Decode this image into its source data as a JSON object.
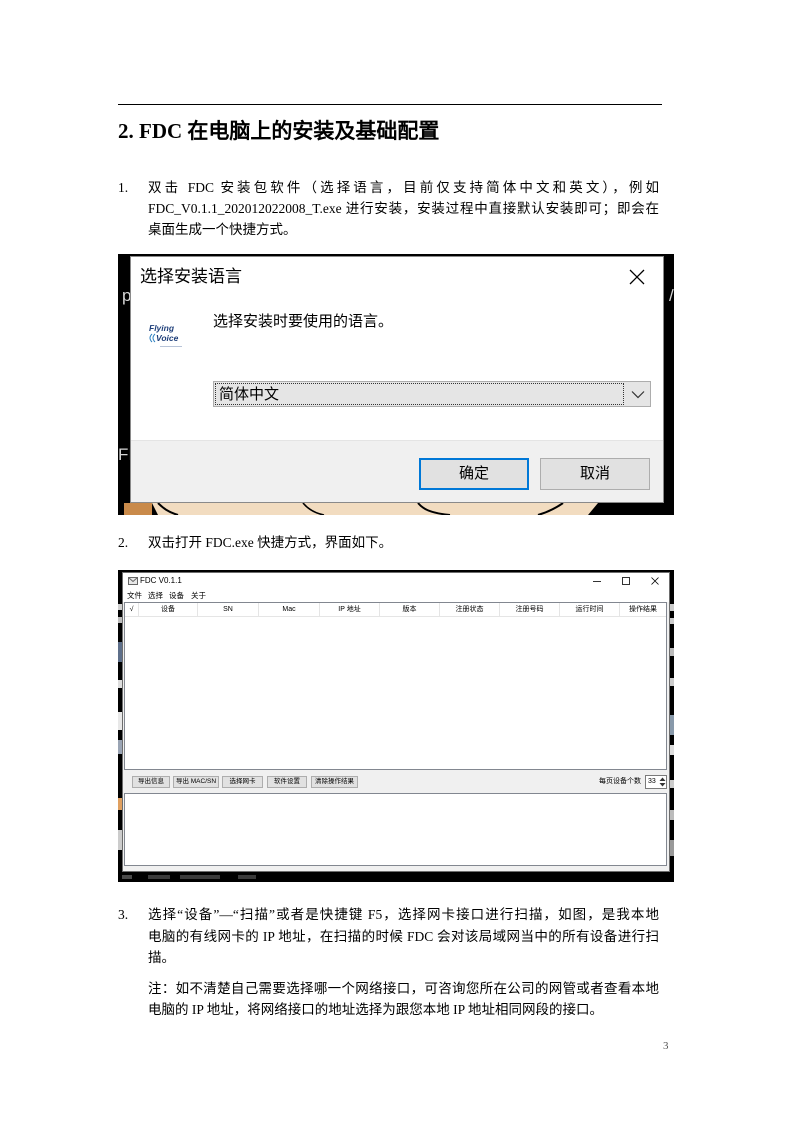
{
  "heading": "2. FDC 在电脑上的安装及基础配置",
  "steps": [
    {
      "marker": "1.",
      "lines": [
        "双击 FDC 安装包软件（选择语言，目前仅支持简体中文和英文），例如",
        "FDC_V0.1.1_202012022008_T.exe 进行安装，安装过程中直接默认安装即可；即会在",
        "桌面生成一个快捷方式。"
      ]
    },
    {
      "marker": "2.",
      "lines": [
        "双击打开 FDC.exe 快捷方式，界面如下。"
      ]
    },
    {
      "marker": "3.",
      "lines": [
        "选择“设备”—“扫描”或者是快捷键 F5，选择网卡接口进行扫描，如图，是我本地",
        "电脑的有线网卡的 IP 地址，在扫描的时候 FDC 会对该局域网当中的所有设备进行扫",
        "描。"
      ],
      "note_lines": [
        "注：如不清楚自己需要选择哪一个网络接口，可咨询您所在公司的网管或者查看本地",
        "电脑的 IP 地址，将网络接口的地址选择为跟您本地 IP 地址相同网段的接口。"
      ]
    }
  ],
  "language_dialog": {
    "title": "选择安装语言",
    "logo_text": [
      "Flying",
      "Voice"
    ],
    "prompt": "选择安装时要使用的语言。",
    "selected_language": "简体中文",
    "ok_label": "确定",
    "cancel_label": "取消",
    "background_fragments": [
      "p",
      "FI",
      "/"
    ],
    "icons": {
      "close": "close-icon",
      "dropdown": "chevron-down-icon"
    },
    "colors": {
      "default_button_border": "#0078d7",
      "footer": "#f0f0f0"
    }
  },
  "fdc_window": {
    "title": "FDC V0.1.1",
    "menu": [
      "文件",
      "选择",
      "设备",
      "关于"
    ],
    "columns": [
      "√",
      "设备",
      "SN",
      "Mac",
      "IP 地址",
      "版本",
      "注册状态",
      "注册号码",
      "运行时间",
      "操作结果"
    ],
    "toolbar_buttons": [
      "导出信息",
      "导出 MAC/SN",
      "选择网卡",
      "软件设置",
      "清除操作结果"
    ],
    "per_page_label": "每页设备个数",
    "per_page_value": "33",
    "icons": {
      "app": "app-icon",
      "minimize": "minimize-icon",
      "maximize": "maximize-icon",
      "close": "close-icon",
      "spin": "spin-arrows-icon"
    }
  },
  "page_number": "3"
}
